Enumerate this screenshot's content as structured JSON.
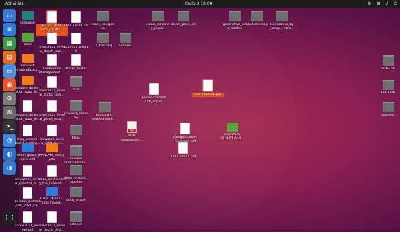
{
  "topbar": {
    "activities": "Activities",
    "clock": "Ioulo 3 10:08",
    "tray": [
      "⚙",
      "⊞",
      "♪",
      "⏻"
    ]
  },
  "dock": [
    {
      "icon": "folder-icon",
      "color": "#3a7ad4",
      "glyph": "▭"
    },
    {
      "icon": "document-icon",
      "color": "#2f7bd8",
      "glyph": "≡"
    },
    {
      "icon": "spreadsheet-icon",
      "color": "#3a9a4b",
      "glyph": "▦"
    },
    {
      "icon": "presentation-icon",
      "color": "#e26c1d",
      "glyph": "▤"
    },
    {
      "icon": "drive-icon",
      "color": "#4d8fd8",
      "glyph": "▭"
    },
    {
      "icon": "firefox-icon",
      "color": "#e4572e",
      "glyph": "◉"
    },
    {
      "icon": "settings-icon",
      "color": "#7a7a7a",
      "glyph": "⚙"
    },
    {
      "icon": "mail-icon",
      "color": "#6a6a6a",
      "glyph": "✉"
    },
    {
      "icon": "terminal-icon",
      "color": "#333333",
      "glyph": ">_"
    },
    {
      "icon": "chat-icon",
      "color": "#3f82d8",
      "glyph": "◔"
    },
    {
      "icon": "browser-icon",
      "color": "#2b6fcf",
      "glyph": "◐"
    },
    {
      "icon": "store-icon",
      "color": "#2f7bd8",
      "glyph": "◑"
    },
    {
      "icon": "app-grid-icon",
      "color": "#222222",
      "glyph": "⋮⋮"
    }
  ],
  "desktop": [
    {
      "label": "kamanan",
      "type": "teal"
    },
    {
      "label": "ICCV21_Neo\nrical_kt-2021\n0.31",
      "type": "doc",
      "selected": true
    },
    {
      "label": "2203.19636.pdf",
      "type": "doc"
    },
    {
      "label": "robot_navigati\non",
      "type": "folder"
    },
    {
      "label": "visual_similarit\ny_graphs",
      "type": "folder"
    },
    {
      "label": "object_pose_3d",
      "type": "folder"
    },
    {
      "label": "generative_per\nc_models",
      "type": "folder"
    },
    {
      "label": "robot_learning",
      "type": "folder"
    },
    {
      "label": "localization_by\n_image_retrie...",
      "type": "folder"
    },
    {
      "label": "Trash",
      "type": "green"
    },
    {
      "label": "bmvc2021_revie\nw_depth_trac...",
      "type": "doc"
    },
    {
      "label": "iccv2021_pwd.p\ndf",
      "type": "doc"
    },
    {
      "label": "3d_tracking",
      "type": "folder"
    },
    {
      "label": "SimReel",
      "type": "folder"
    },
    {
      "label": "Tempest\nImagingEcosy...",
      "type": "orange"
    },
    {
      "label": "Conference\nManagement ...",
      "type": "doc"
    },
    {
      "label": "PDFFix_Instas",
      "type": "doc"
    },
    {
      "label": "SCN-Lab",
      "type": "folder"
    },
    {
      "label": "gesture_dissert\nation_robo_th...",
      "type": "orange"
    },
    {
      "label": "bmvc2021_revie\nw_static_cam...",
      "type": "doc"
    },
    {
      "label": "misc",
      "type": "folder"
    },
    {
      "label": "EuroEuroscope\n_CLK_Topics...",
      "type": "doc"
    },
    {
      "label": "cvo-paper21.pdf",
      "type": "doc",
      "selected": true
    },
    {
      "label": "EEE IAPR",
      "type": "folder"
    },
    {
      "label": "gesture_dissert\nation_robo_th...",
      "type": "doc"
    },
    {
      "label": "bmvc2021_revie\nw_place_reco...",
      "type": "doc"
    },
    {
      "label": "research_fundi\nng",
      "type": "folder"
    },
    {
      "label": "horizon24-\nrevised-draft-...",
      "type": "folder"
    },
    {
      "label": "Dropbox",
      "type": "folder"
    },
    {
      "label": "King_Entries-\nkind_Learning...",
      "type": "doc"
    },
    {
      "label": "iccv2021_revie\nw_rgbd_trac...",
      "type": "doc"
    },
    {
      "label": "ROSE",
      "type": "folder"
    },
    {
      "label": "MDP-\nAutonomist(...",
      "type": "pdf"
    },
    {
      "label": "categorization-\nConcepts.pdf",
      "type": "doc"
    },
    {
      "label": "SCN Week\n2019-07 Anal...",
      "type": "green"
    },
    {
      "label": "vision_group_t\nopics.odt",
      "type": "blue"
    },
    {
      "label": "RANCAM_joint.p\npdx",
      "type": "orange"
    },
    {
      "label": "Huawei\nkandipadkma...",
      "type": "folder"
    },
    {
      "label": "2201.03545.pdf",
      "type": "doc"
    },
    {
      "label": "bmvc2021_revie\nw_spectral_cu...",
      "type": "doc"
    },
    {
      "label": "Oban_Bethlehem\ng_the_Evaluati...",
      "type": "doc"
    },
    {
      "label": "deep_imaging_\npipeline",
      "type": "folder"
    },
    {
      "label": "Huawei_summit\n_talk_2021_De...",
      "type": "doc"
    },
    {
      "label": "Call-CLX-2021-\nThCM TRANS...",
      "type": "blue"
    },
    {
      "label": "body_shape",
      "type": "folder"
    },
    {
      "label": "iccvw2021_revi\newi.pdf",
      "type": "doc"
    },
    {
      "label": "bmvc2021_revie\nw_depth_dekl...",
      "type": "doc"
    },
    {
      "label": "votable!",
      "type": "folder"
    }
  ]
}
